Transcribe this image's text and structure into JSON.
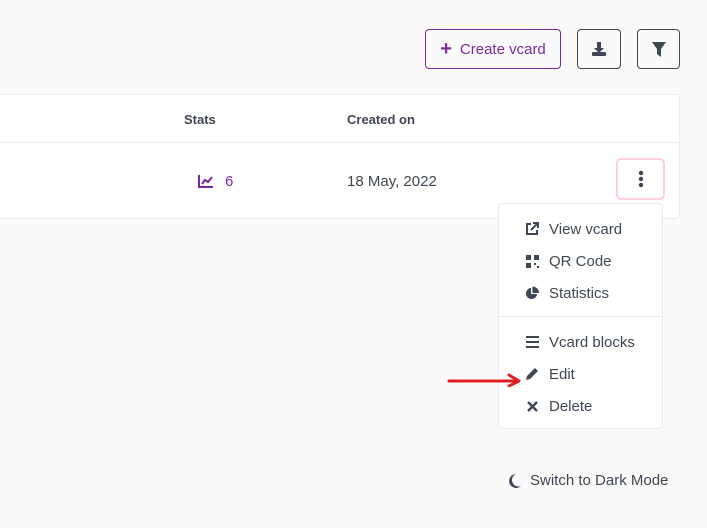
{
  "toolbar": {
    "create_label": "Create vcard",
    "create_icon": "plus-icon",
    "download_icon": "download-icon",
    "filter_icon": "filter-icon"
  },
  "table": {
    "headers": {
      "stats": "Stats",
      "created_on": "Created on"
    },
    "rows": [
      {
        "stats": "6",
        "created_on": "18 May, 2022"
      }
    ]
  },
  "menu": {
    "items": [
      {
        "label": "View vcard",
        "icon": "external-link-icon"
      },
      {
        "label": "QR Code",
        "icon": "qrcode-icon"
      },
      {
        "label": "Statistics",
        "icon": "pie-chart-icon"
      },
      {
        "label": "Vcard blocks",
        "icon": "bars-icon"
      },
      {
        "label": "Edit",
        "icon": "pencil-icon"
      },
      {
        "label": "Delete",
        "icon": "times-icon"
      }
    ]
  },
  "footer": {
    "dark_mode_label": "Switch to Dark Mode"
  },
  "colors": {
    "accent": "#7b2a9e",
    "annotation_arrow": "#e02020",
    "kebab_border": "#f9cfe1"
  }
}
